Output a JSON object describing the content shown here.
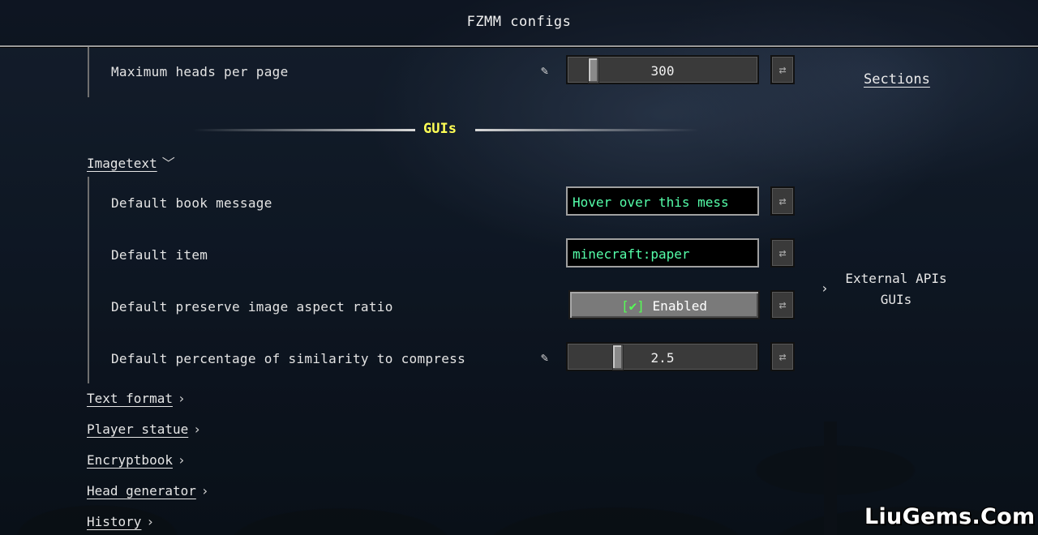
{
  "window": {
    "title": "FZMM configs"
  },
  "sections_link": "Sections",
  "colors": {
    "section_title": "#ffff55",
    "text_value": "#55ffaa",
    "checkmark": "#55ff55"
  },
  "top_option": {
    "label": "Maximum heads per page",
    "value": "300",
    "slider_fraction": 0.1
  },
  "section": {
    "title": "GUIs"
  },
  "imagetext": {
    "label": "Imagetext",
    "expanded": true,
    "options": {
      "book_message": {
        "label": "Default book message",
        "value": "Hover over this mess"
      },
      "item": {
        "label": "Default item",
        "value": "minecraft:paper"
      },
      "aspect_ratio": {
        "label": "Default preserve image aspect ratio",
        "check": "[✔]",
        "value": "Enabled"
      },
      "similarity": {
        "label": "Default percentage of similarity to compress",
        "value": "2.5",
        "slider_fraction": 0.25
      }
    }
  },
  "categories": [
    {
      "label": "Text format"
    },
    {
      "label": "Player statue"
    },
    {
      "label": "Encryptbook"
    },
    {
      "label": "Head generator"
    },
    {
      "label": "History"
    }
  ],
  "sidebar": {
    "item_line1": "External APIs",
    "item_line2": "GUIs"
  },
  "icons": {
    "edit": "pencil-icon",
    "reset": "reset-arrows-icon",
    "expand": "chevron-down-icon",
    "collapse": "chevron-right-icon"
  },
  "watermark": "LiuGems.Com"
}
